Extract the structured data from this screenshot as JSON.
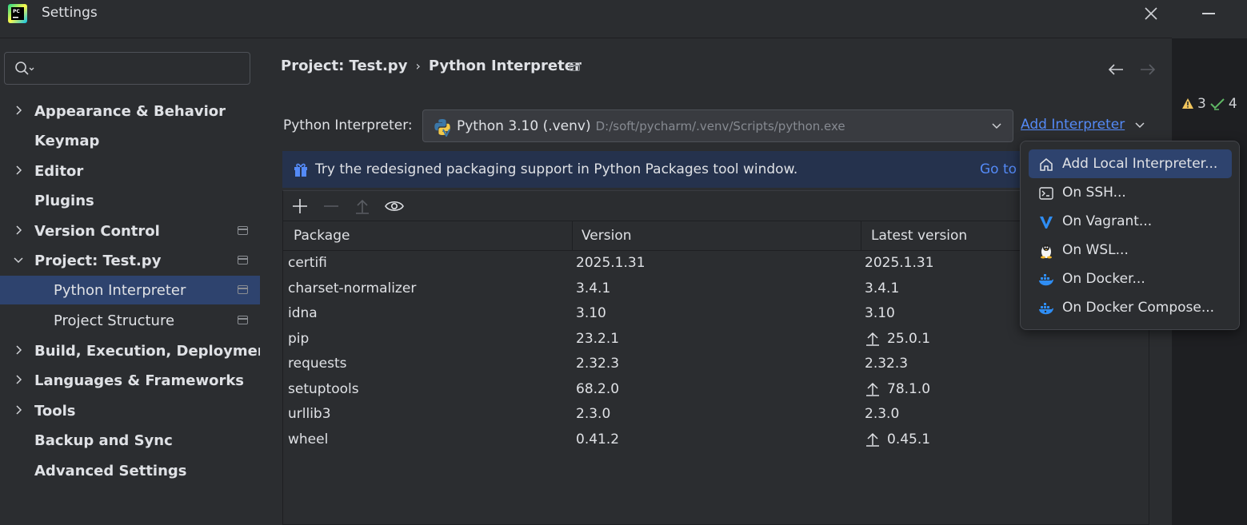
{
  "window": {
    "title": "Settings"
  },
  "sidebar": {
    "search_placeholder": "",
    "items": [
      {
        "label": "Appearance & Behavior"
      },
      {
        "label": "Keymap"
      },
      {
        "label": "Editor"
      },
      {
        "label": "Plugins"
      },
      {
        "label": "Version Control"
      },
      {
        "label": "Project: Test.py"
      },
      {
        "label": "Python Interpreter"
      },
      {
        "label": "Project Structure"
      },
      {
        "label": "Build, Execution, Deployment"
      },
      {
        "label": "Languages & Frameworks"
      },
      {
        "label": "Tools"
      },
      {
        "label": "Backup and Sync"
      },
      {
        "label": "Advanced Settings"
      }
    ]
  },
  "breadcrumb": {
    "project": "Project: Test.py",
    "separator": "›",
    "page": "Python Interpreter"
  },
  "interpreter": {
    "label": "Python Interpreter:",
    "name": "Python 3.10 (.venv)",
    "path": "D:/soft/pycharm/.venv/Scripts/python.exe",
    "add_label": "Add Interpreter"
  },
  "banner": {
    "message": "Try the redesigned packaging support in Python Packages tool window.",
    "link": "Go to"
  },
  "table": {
    "columns": [
      "Package",
      "Version",
      "Latest version"
    ],
    "rows": [
      {
        "package": "certifi",
        "version": "2025.1.31",
        "latest": "2025.1.31",
        "upgrade": false
      },
      {
        "package": "charset-normalizer",
        "version": "3.4.1",
        "latest": "3.4.1",
        "upgrade": false
      },
      {
        "package": "idna",
        "version": "3.10",
        "latest": "3.10",
        "upgrade": false
      },
      {
        "package": "pip",
        "version": "23.2.1",
        "latest": "25.0.1",
        "upgrade": true
      },
      {
        "package": "requests",
        "version": "2.32.3",
        "latest": "2.32.3",
        "upgrade": false
      },
      {
        "package": "setuptools",
        "version": "68.2.0",
        "latest": "78.1.0",
        "upgrade": true
      },
      {
        "package": "urllib3",
        "version": "2.3.0",
        "latest": "2.3.0",
        "upgrade": false
      },
      {
        "package": "wheel",
        "version": "0.41.2",
        "latest": "0.45.1",
        "upgrade": true
      }
    ]
  },
  "menu": {
    "items": [
      {
        "label": "Add Local Interpreter...",
        "icon": "home-icon"
      },
      {
        "label": "On SSH...",
        "icon": "terminal-icon"
      },
      {
        "label": "On Vagrant...",
        "icon": "vagrant-icon"
      },
      {
        "label": "On WSL...",
        "icon": "linux-icon"
      },
      {
        "label": "On Docker...",
        "icon": "docker-icon"
      },
      {
        "label": "On Docker Compose...",
        "icon": "docker-compose-icon"
      }
    ]
  },
  "inspections": {
    "warnings": "3",
    "checks": "4"
  },
  "colors": {
    "accent": "#548af7",
    "selection": "#2e436e",
    "banner": "#25324d",
    "background": "#2b2d30"
  }
}
